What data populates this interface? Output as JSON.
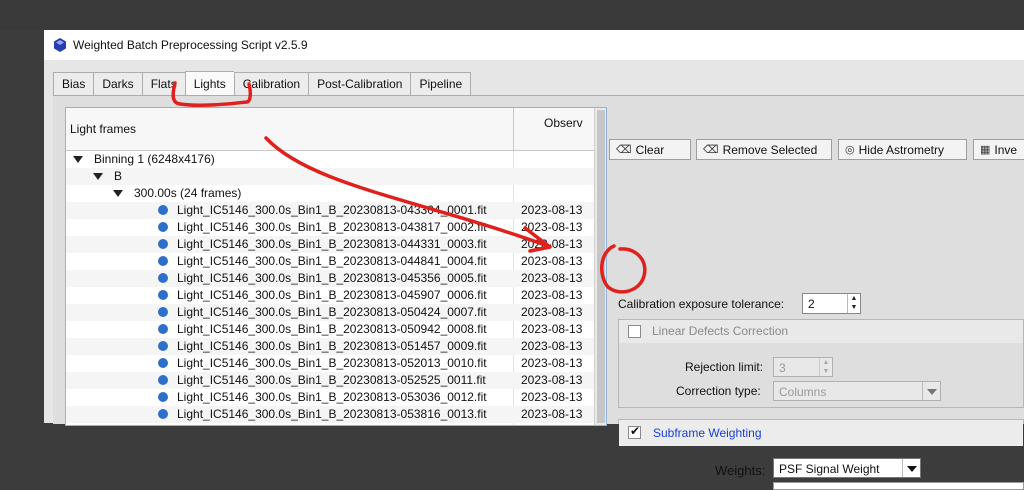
{
  "window": {
    "title": "Weighted Batch Preprocessing Script v2.5.9"
  },
  "tabs": [
    {
      "label": "Bias",
      "active": false
    },
    {
      "label": "Darks",
      "active": false
    },
    {
      "label": "Flats",
      "active": false
    },
    {
      "label": "Lights",
      "active": true
    },
    {
      "label": "Calibration",
      "active": false
    },
    {
      "label": "Post-Calibration",
      "active": false
    },
    {
      "label": "Pipeline",
      "active": false
    }
  ],
  "tree": {
    "col_name": "Light frames",
    "col_obs": "Observ",
    "binning_label": "Binning 1 (6248x4176)",
    "filter_label": "B",
    "exposure_label": "300.00s (24 frames)",
    "files": [
      {
        "name": "Light_IC5146_300.0s_Bin1_B_20230813-043304_0001.fit",
        "date": "2023-08-13"
      },
      {
        "name": "Light_IC5146_300.0s_Bin1_B_20230813-043817_0002.fit",
        "date": "2023-08-13"
      },
      {
        "name": "Light_IC5146_300.0s_Bin1_B_20230813-044331_0003.fit",
        "date": "2023-08-13"
      },
      {
        "name": "Light_IC5146_300.0s_Bin1_B_20230813-044841_0004.fit",
        "date": "2023-08-13"
      },
      {
        "name": "Light_IC5146_300.0s_Bin1_B_20230813-045356_0005.fit",
        "date": "2023-08-13"
      },
      {
        "name": "Light_IC5146_300.0s_Bin1_B_20230813-045907_0006.fit",
        "date": "2023-08-13"
      },
      {
        "name": "Light_IC5146_300.0s_Bin1_B_20230813-050424_0007.fit",
        "date": "2023-08-13"
      },
      {
        "name": "Light_IC5146_300.0s_Bin1_B_20230813-050942_0008.fit",
        "date": "2023-08-13"
      },
      {
        "name": "Light_IC5146_300.0s_Bin1_B_20230813-051457_0009.fit",
        "date": "2023-08-13"
      },
      {
        "name": "Light_IC5146_300.0s_Bin1_B_20230813-052013_0010.fit",
        "date": "2023-08-13"
      },
      {
        "name": "Light_IC5146_300.0s_Bin1_B_20230813-052525_0011.fit",
        "date": "2023-08-13"
      },
      {
        "name": "Light_IC5146_300.0s_Bin1_B_20230813-053036_0012.fit",
        "date": "2023-08-13"
      },
      {
        "name": "Light_IC5146_300.0s_Bin1_B_20230813-053816_0013.fit",
        "date": "2023-08-13"
      }
    ]
  },
  "toolbar": {
    "clear": "Clear",
    "remove_selected": "Remove Selected",
    "hide_astrometry": "Hide Astrometry",
    "invert": "Inve"
  },
  "calibration": {
    "tolerance_label": "Calibration exposure tolerance:",
    "tolerance_value": "2"
  },
  "linear_defects": {
    "title": "Linear Defects Correction",
    "checked": false,
    "rejection_label": "Rejection limit:",
    "rejection_value": "3",
    "correction_label": "Correction type:",
    "correction_value": "Columns"
  },
  "subframe_weighting": {
    "title": "Subframe Weighting",
    "checked": true,
    "weights_label": "Weights:",
    "weights_value": "PSF Signal Weight"
  },
  "colors": {
    "annotation_red": "#e0201c",
    "accent_blue": "#2e6fc9",
    "link_blue": "#1a3fd0"
  }
}
